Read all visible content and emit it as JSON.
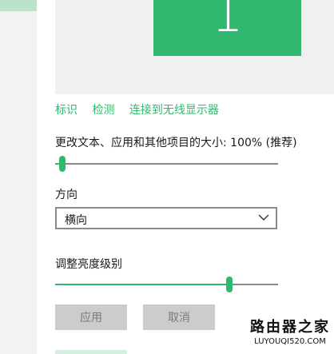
{
  "display": {
    "monitor_number": "1"
  },
  "links": [
    "标识",
    "检测",
    "连接到无线显示器"
  ],
  "scale": {
    "label": "更改文本、应用和其他项目的大小: 100% (推荐)",
    "value_fraction": 0.02
  },
  "orientation": {
    "label": "方向",
    "selected": "横向"
  },
  "brightness": {
    "label": "调整亮度级别",
    "value_fraction": 0.79
  },
  "buttons": {
    "apply": "应用",
    "cancel": "取消"
  },
  "watermark": {
    "main": "路由器之家",
    "sub": "LUYOUQI520.COM"
  },
  "colors": {
    "accent": "#2fb86e",
    "disabled": "#cccccc"
  }
}
